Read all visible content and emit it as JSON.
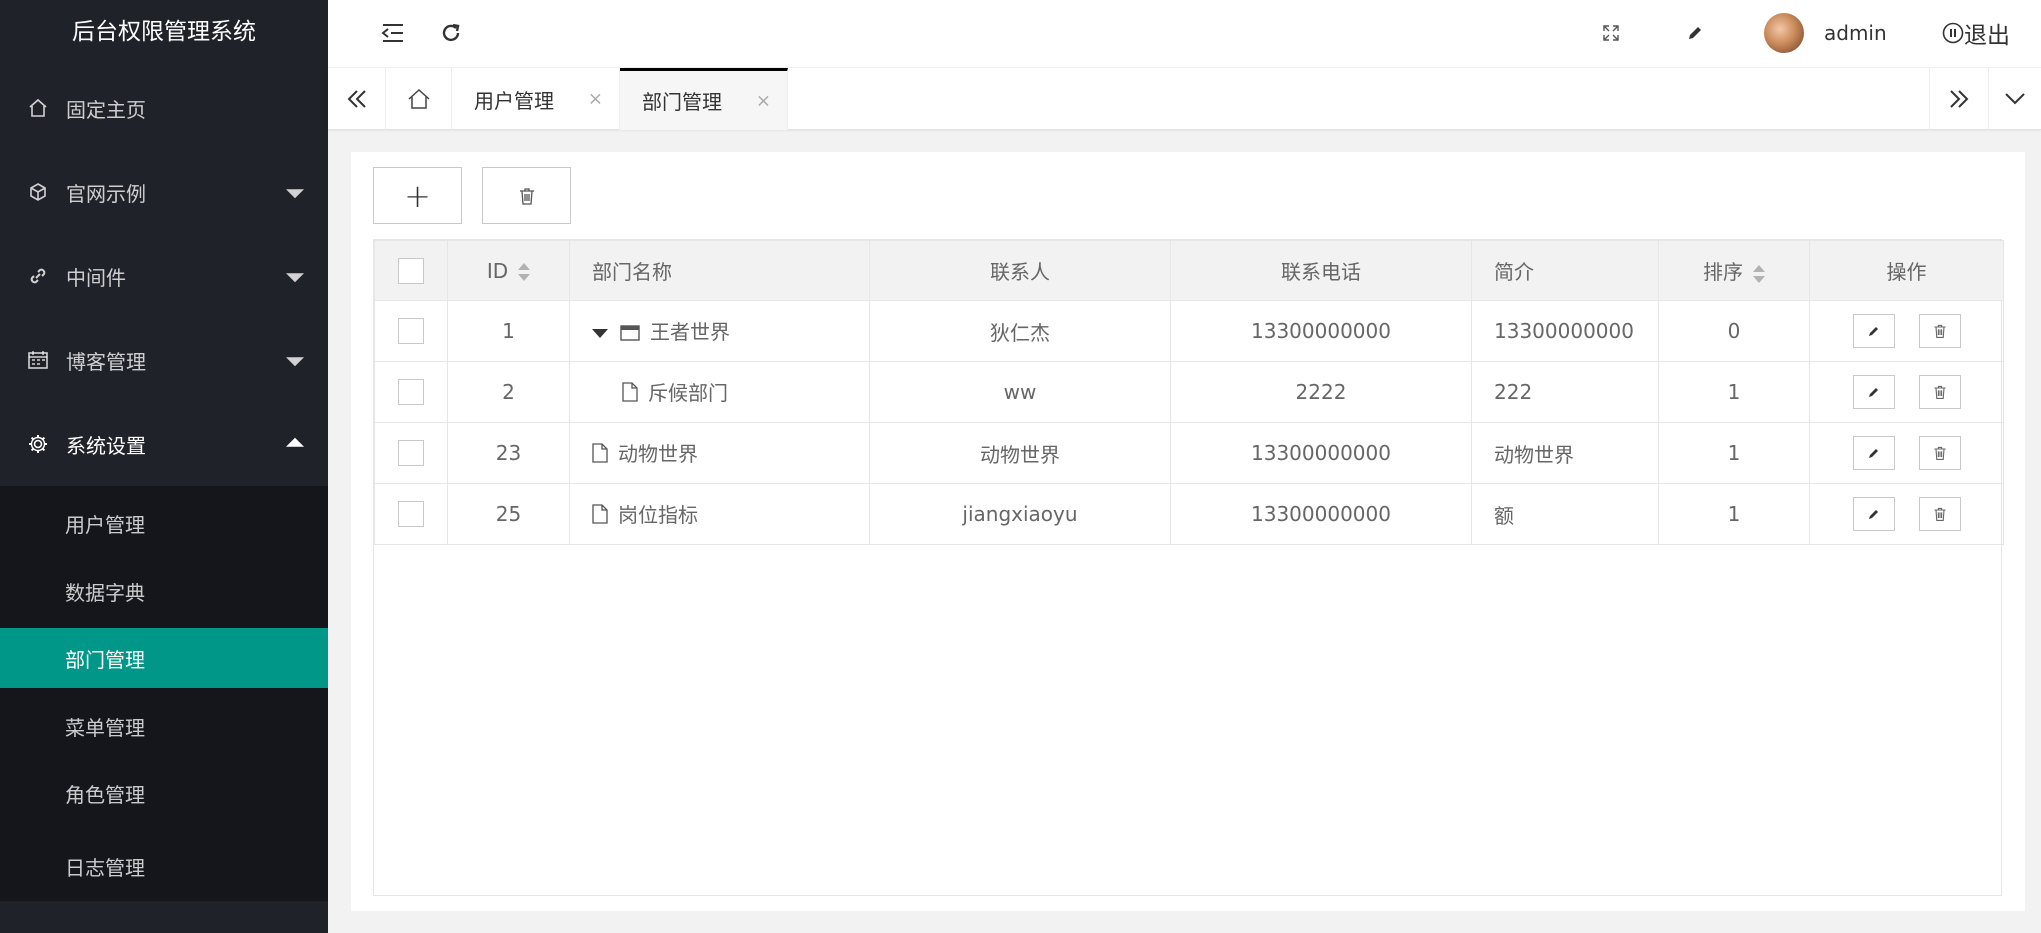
{
  "app": {
    "title": "后台权限管理系统"
  },
  "sidebar": {
    "items": [
      {
        "label": "固定主页",
        "icon": "home-icon"
      },
      {
        "label": "官网示例",
        "icon": "cube-icon"
      },
      {
        "label": "中间件",
        "icon": "link-icon"
      },
      {
        "label": "博客管理",
        "icon": "calendar-icon"
      },
      {
        "label": "系统设置",
        "icon": "gear-icon"
      }
    ],
    "submenu": [
      {
        "label": "用户管理"
      },
      {
        "label": "数据字典"
      },
      {
        "label": "部门管理"
      },
      {
        "label": "菜单管理"
      },
      {
        "label": "角色管理"
      },
      {
        "label": "日志管理"
      }
    ]
  },
  "header": {
    "username": "admin",
    "logout_label": "退出"
  },
  "tabs": [
    {
      "label": "用户管理",
      "close": "×"
    },
    {
      "label": "部门管理",
      "close": "×"
    }
  ],
  "toolbar": {
    "add_label": "+"
  },
  "table": {
    "columns": [
      "ID",
      "部门名称",
      "联系人",
      "联系电话",
      "简介",
      "排序",
      "操作"
    ],
    "rows": [
      {
        "id": "1",
        "name": "王者世界",
        "contact": "狄仁杰",
        "phone": "13300000000",
        "intro": "13300000000",
        "sort": "0"
      },
      {
        "id": "2",
        "name": "斥候部门",
        "contact": "ww",
        "phone": "2222",
        "intro": "222",
        "sort": "1"
      },
      {
        "id": "23",
        "name": "动物世界",
        "contact": "动物世界",
        "phone": "13300000000",
        "intro": "动物世界",
        "sort": "1"
      },
      {
        "id": "25",
        "name": "岗位指标",
        "contact": "jiangxiaoyu",
        "phone": "13300000000",
        "intro": "额",
        "sort": "1"
      }
    ]
  }
}
